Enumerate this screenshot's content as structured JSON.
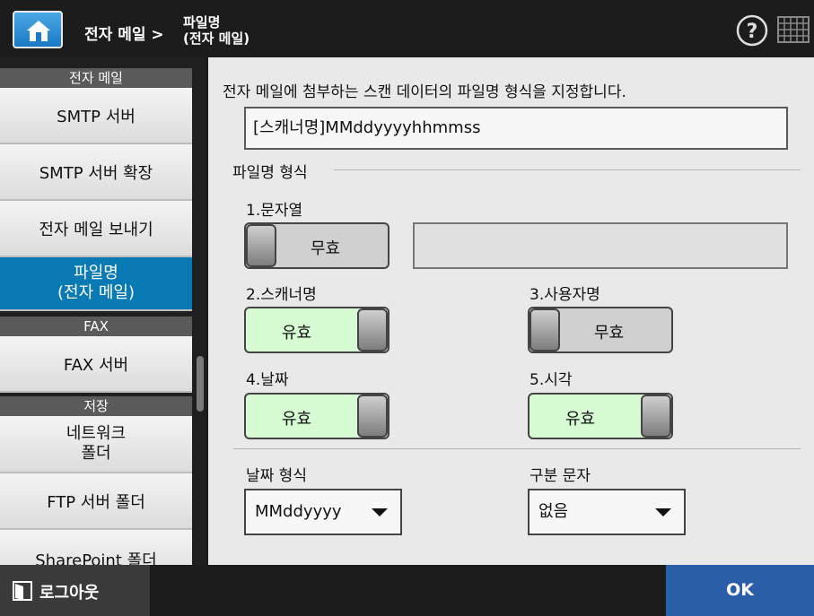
{
  "header": {
    "breadcrumb": "전자 메일 >",
    "title_line1": "파일명",
    "title_line2": "(전자 메일)",
    "help_symbol": "?"
  },
  "sidebar": {
    "sections": [
      {
        "header": "전자 메일",
        "items": [
          "SMTP 서버",
          "SMTP 서버 확장",
          "전자 메일 보내기"
        ]
      },
      {
        "header": "FAX",
        "items": [
          "FAX 서버"
        ]
      },
      {
        "header": "저장",
        "items": [
          "FTP 서버 폴더",
          "SharePoint 폴더"
        ]
      }
    ],
    "active_item_line1": "파일명",
    "active_item_line2": "(전자 메일)",
    "network_folder_line1": "네트워크",
    "network_folder_line2": "폴더"
  },
  "content": {
    "description": "전자 메일에 첨부하는 스캔 데이터의 파일명 형식을 지정합니다.",
    "preview": "[스캐너명]MMddyyyyhhmmss",
    "group_title": "파일명 형식",
    "options": [
      {
        "label": "1.문자열",
        "state": "무효",
        "enabled": false
      },
      {
        "label": "2.스캐너명",
        "state": "유효",
        "enabled": true
      },
      {
        "label": "3.사용자명",
        "state": "무효",
        "enabled": false
      },
      {
        "label": "4.날짜",
        "state": "유효",
        "enabled": true
      },
      {
        "label": "5.시각",
        "state": "유효",
        "enabled": true
      }
    ],
    "string_value": "",
    "date_format": {
      "label": "날짜 형식",
      "value": "MMddyyyy"
    },
    "separator": {
      "label": "구분 문자",
      "value": "없음"
    }
  },
  "footer": {
    "logout_label": "로그아웃",
    "ok_label": "OK"
  },
  "colors": {
    "active_nav": "#0a7ab4",
    "toggle_on": "#d7fbd2",
    "toggle_off": "#d0d0d0",
    "ok_button": "#2a5ea8",
    "home_button": "#1b79c4"
  }
}
